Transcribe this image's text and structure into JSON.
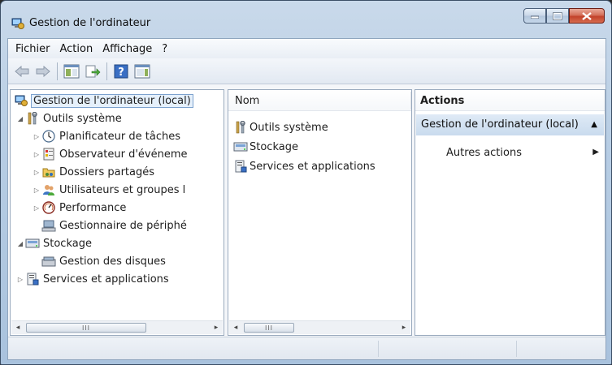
{
  "window": {
    "title": "Gestion de l'ordinateur"
  },
  "menu": [
    "Fichier",
    "Action",
    "Affichage",
    "?"
  ],
  "tree": {
    "items": [
      {
        "label": "Gestion de l'ordinateur (local)",
        "icon": "computer-management-icon",
        "expander": "",
        "selected": true
      },
      {
        "label": "Outils système",
        "icon": "tools-icon",
        "expander": "expanded"
      },
      {
        "label": "Planificateur de tâches",
        "icon": "clock-icon",
        "expander": "collapsed"
      },
      {
        "label": "Observateur d'événeme",
        "icon": "event-viewer-icon",
        "expander": "collapsed"
      },
      {
        "label": "Dossiers partagés",
        "icon": "shared-folder-icon",
        "expander": "collapsed"
      },
      {
        "label": "Utilisateurs et groupes l",
        "icon": "users-icon",
        "expander": "collapsed"
      },
      {
        "label": "Performance",
        "icon": "performance-icon",
        "expander": "collapsed"
      },
      {
        "label": "Gestionnaire de périphé",
        "icon": "device-manager-icon",
        "expander": ""
      },
      {
        "label": "Stockage",
        "icon": "storage-icon",
        "expander": "expanded"
      },
      {
        "label": "Gestion des disques",
        "icon": "disk-icon",
        "expander": ""
      },
      {
        "label": "Services et applications",
        "icon": "services-icon",
        "expander": "collapsed"
      }
    ],
    "scroll_thumb": "III"
  },
  "list": {
    "column": "Nom",
    "items": [
      {
        "label": "Outils système",
        "icon": "tools-icon"
      },
      {
        "label": "Stockage",
        "icon": "storage-icon"
      },
      {
        "label": "Services et applications",
        "icon": "services-icon"
      }
    ],
    "scroll_thumb": "III"
  },
  "actions": {
    "title": "Actions",
    "group": "Gestion de l'ordinateur (local)",
    "items": [
      "Autres actions"
    ]
  }
}
